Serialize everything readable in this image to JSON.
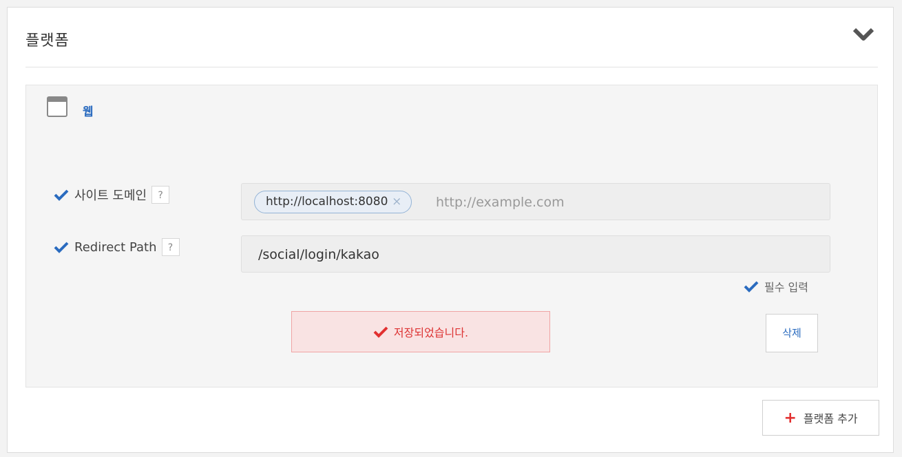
{
  "section": {
    "title": "플랫폼",
    "collapse_icon": "chevron-down-icon"
  },
  "platform": {
    "type_label": "웹",
    "type_icon": "browser-window-icon",
    "site_domain": {
      "label": "사이트 도메인",
      "help": "?",
      "tags": [
        "http://localhost:8080"
      ],
      "tag_remove": "×",
      "placeholder": "http://example.com"
    },
    "redirect_path": {
      "label": "Redirect Path",
      "help": "?",
      "value": "/social/login/kakao"
    },
    "required_note": "필수 입력",
    "alert": "저장되었습니다.",
    "delete_label": "삭제"
  },
  "add_platform": {
    "label": "플랫폼 추가",
    "icon": "+"
  },
  "colors": {
    "accent": "#2a6bbf",
    "alert_text": "#d33333",
    "add_plus": "#e23030"
  }
}
